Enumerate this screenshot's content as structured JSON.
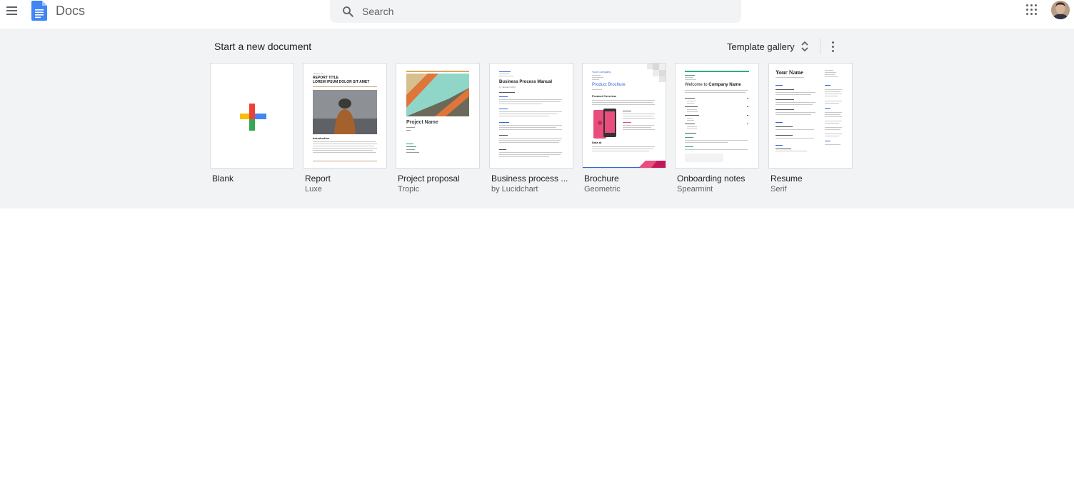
{
  "header": {
    "app_name": "Docs",
    "search": {
      "placeholder": "Search",
      "value": ""
    }
  },
  "section": {
    "title": "Start a new document",
    "gallery_label": "Template gallery"
  },
  "templates": [
    {
      "name": "Blank",
      "subtitle": ""
    },
    {
      "name": "Report",
      "subtitle": "Luxe",
      "preview": {
        "kicker": "Report title",
        "title": "REPORT TITLE",
        "subtitle": "LOREM IPSUM DOLOR SIT AMET",
        "heading": "Introduction"
      }
    },
    {
      "name": "Project proposal",
      "subtitle": "Tropic",
      "preview": {
        "title": "Project Name"
      }
    },
    {
      "name": "Business process ...",
      "subtitle": "by Lucidchart",
      "preview": {
        "title": "Business Process Manual",
        "date": "17 January 20XX"
      }
    },
    {
      "name": "Brochure",
      "subtitle": "Geometric",
      "preview": {
        "company": "Your Company",
        "title": "Product Brochure",
        "heading": "Product Overview",
        "footer_heading": "Data at"
      }
    },
    {
      "name": "Onboarding notes",
      "subtitle": "Spearmint",
      "preview": {
        "prefix": "Welcome to",
        "company": "Company Name"
      }
    },
    {
      "name": "Resume",
      "subtitle": "Serif",
      "preview": {
        "name": "Your Name"
      }
    }
  ],
  "colors": {
    "band": "#f1f3f4",
    "google_blue": "#4285f4",
    "google_red": "#ea4335",
    "google_yellow": "#fbbc04",
    "google_green": "#34a853"
  },
  "icons": [
    "menu-icon",
    "docs-logo-icon",
    "search-icon",
    "apps-grid-icon",
    "avatar",
    "unfold-icon",
    "more-vert-icon",
    "plus-icon"
  ]
}
